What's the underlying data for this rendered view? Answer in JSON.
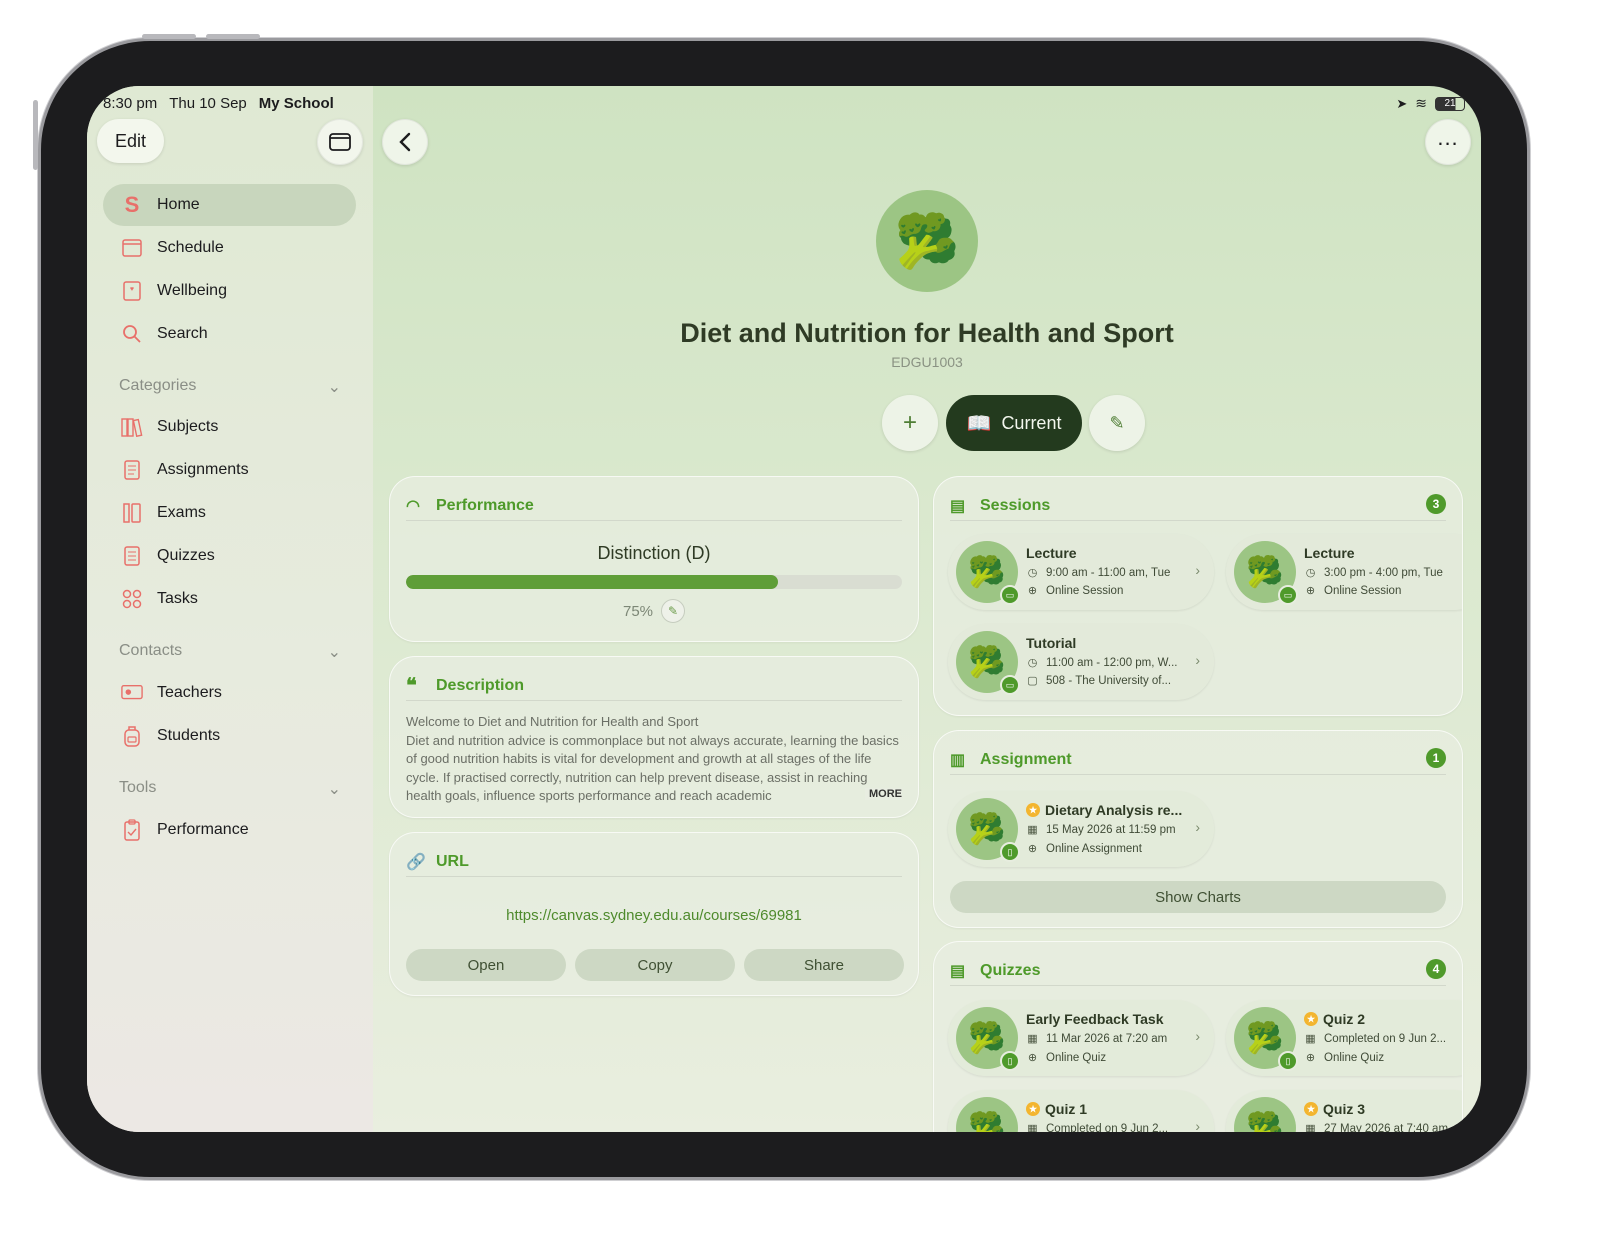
{
  "status": {
    "time": "8:30 pm",
    "date": "Thu 10 Sep",
    "carrier": "My School",
    "battery": "21"
  },
  "sidebar": {
    "edit_label": "Edit",
    "items": [
      {
        "label": "Home",
        "icon": "app-logo-icon"
      },
      {
        "label": "Schedule",
        "icon": "calendar-icon"
      },
      {
        "label": "Wellbeing",
        "icon": "heart-card-icon"
      },
      {
        "label": "Search",
        "icon": "search-icon"
      }
    ],
    "categories": {
      "title": "Categories",
      "items": [
        {
          "label": "Subjects",
          "icon": "books-icon"
        },
        {
          "label": "Assignments",
          "icon": "document-icon"
        },
        {
          "label": "Exams",
          "icon": "exam-icon"
        },
        {
          "label": "Quizzes",
          "icon": "quiz-icon"
        },
        {
          "label": "Tasks",
          "icon": "tasks-icon"
        }
      ]
    },
    "contacts": {
      "title": "Contacts",
      "items": [
        {
          "label": "Teachers",
          "icon": "teacher-icon"
        },
        {
          "label": "Students",
          "icon": "backpack-icon"
        }
      ]
    },
    "tools": {
      "title": "Tools",
      "items": [
        {
          "label": "Performance",
          "icon": "clipboard-icon"
        }
      ]
    }
  },
  "course": {
    "emoji": "🥦",
    "title": "Diet and Nutrition for Health and Sport",
    "code": "EDGU1003",
    "status_label": "Current"
  },
  "performance": {
    "title": "Performance",
    "grade": "Distinction (D)",
    "percent_label": "75%",
    "fraction": 0.75
  },
  "description": {
    "title": "Description",
    "line1": "Welcome to Diet and Nutrition for Health and Sport",
    "body": "Diet and nutrition advice is commonplace but not always accurate, learning the basics of good nutrition habits is vital for development and growth at all stages of the life cycle. If practised correctly, nutrition can help prevent disease, assist in reaching health goals, influence sports performance and reach academic",
    "more": "MORE"
  },
  "url": {
    "title": "URL",
    "value": "https://canvas.sydney.edu.au/courses/69981",
    "open": "Open",
    "copy": "Copy",
    "share": "Share"
  },
  "sessions": {
    "title": "Sessions",
    "count": "3",
    "items": [
      {
        "title": "Lecture",
        "time": "9:00 am - 11:00 am, Tue",
        "place": "Online Session"
      },
      {
        "title": "Lecture",
        "time": "3:00 pm - 4:00 pm, Tue",
        "place": "Online Session"
      },
      {
        "title": "Tutorial",
        "time": "11:00 am - 12:00 pm, W...",
        "place": "508 - The University of..."
      }
    ]
  },
  "assignment": {
    "title": "Assignment",
    "count": "1",
    "items": [
      {
        "title": "Dietary Analysis re...",
        "date": "15 May 2026 at 11:59 pm",
        "place": "Online Assignment"
      }
    ],
    "show_charts": "Show Charts"
  },
  "quizzes": {
    "title": "Quizzes",
    "count": "4",
    "items": [
      {
        "title": "Early Feedback Task",
        "date": "11 Mar 2026 at 7:20 am",
        "place": "Online Quiz"
      },
      {
        "title": "Quiz 2",
        "date": "Completed on 9 Jun 2...",
        "place": "Online Quiz"
      },
      {
        "title": "Quiz 1",
        "date": "Completed on 9 Jun 2..."
      },
      {
        "title": "Quiz 3",
        "date": "27 May 2026 at 7:40 am"
      }
    ]
  },
  "colors": {
    "accent": "#4f9a2b",
    "dark_pill": "#233a1e",
    "sidebar_icon": "#e8706a"
  }
}
